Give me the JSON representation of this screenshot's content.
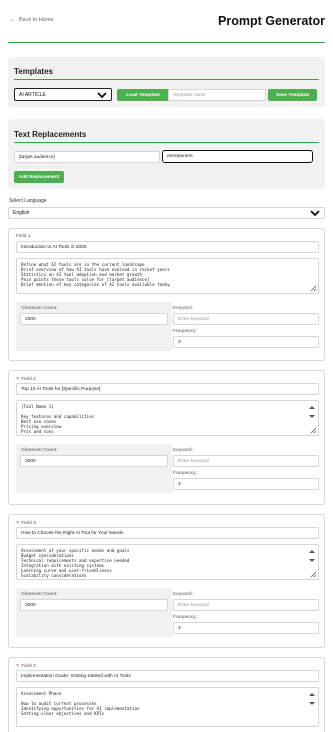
{
  "header": {
    "back_label": "Back to Home",
    "title": "Prompt Generator"
  },
  "templates": {
    "heading": "Templates",
    "selected": "AI ARTICLE",
    "load_button": "Load Template",
    "name_placeholder": "Template name",
    "save_button": "Save Template"
  },
  "replacements": {
    "heading": "Text Replacements",
    "find_value": "[target audience]",
    "replace_value": "entrepeners",
    "add_button": "Add Replacement"
  },
  "language": {
    "label": "Select Language",
    "selected": "English"
  },
  "field_labels": {
    "character_count": "Character Count:",
    "keyword": "Keyword:",
    "keyword_placeholder": "Enter keyword",
    "frequency": "Frequency:"
  },
  "fields": [
    {
      "label": "Field 1:",
      "has_remove": false,
      "title": "Introduction to AI Tools in 2025",
      "body": "Define what AI tools are in the current landscape\nBrief overview of how AI tools have evolved in recent years\nStatistics on AI tool adoption and market growth\nPain points these tools solve for [target audience]\nBrief mention of key categories of AI tools available today",
      "character_count": "2000",
      "frequency": "3"
    },
    {
      "label": "Field 2:",
      "has_remove": true,
      "title": "Top 10 AI Tools for [Specific Purpose]",
      "body": "[Tool Name 1]\n\nKey features and capabilities\nBest use cases\nPricing overview\nPros and cons",
      "character_count": "2000",
      "frequency": "3"
    },
    {
      "label": "Field 3:",
      "has_remove": true,
      "title": "How to Choose the Right AI Tool for Your Needs",
      "body": "Assessment of your specific needs and goals\nBudget considerations\nTechnical requirements and expertise needed\nIntegration with existing systems\nLearning curve and user-friendliness\nScalability considerations",
      "character_count": "2000",
      "frequency": "3"
    },
    {
      "label": "Field 4:",
      "has_remove": true,
      "title": "Implementation Guide: Getting Started with AI Tools",
      "body": "Assessment Phase\n\nHow to audit current processes\nIdentifying opportunities for AI implementation\nSetting clear objectives and KPIs",
      "character_count": "",
      "frequency": ""
    }
  ]
}
